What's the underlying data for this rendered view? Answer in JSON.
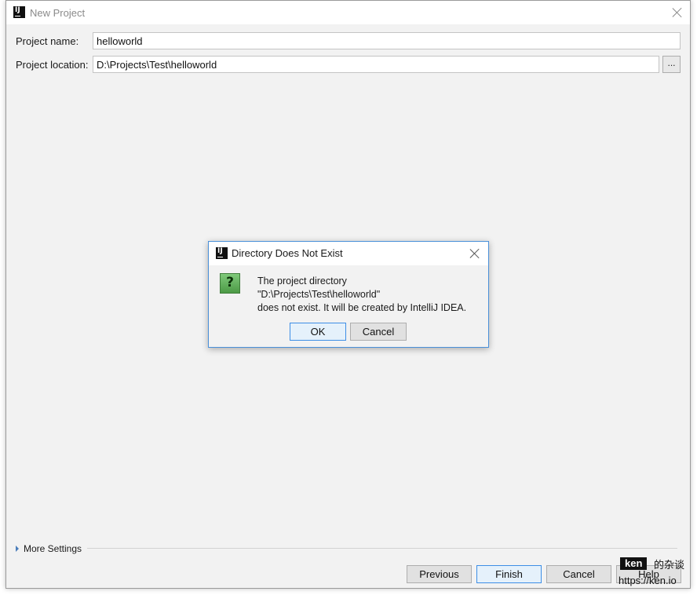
{
  "window": {
    "title": "New Project",
    "logo_text": "IJ"
  },
  "form": {
    "name_label": "Project name:",
    "name_value": "helloworld",
    "location_label": "Project location:",
    "location_value": "D:\\Projects\\Test\\helloworld",
    "browse_label": "..."
  },
  "more_settings": {
    "label": "More Settings"
  },
  "footer": {
    "previous_label": "Previous",
    "finish_label": "Finish",
    "cancel_label": "Cancel",
    "help_label": "Help"
  },
  "dialog": {
    "title": "Directory Does Not Exist",
    "logo_text": "IJ",
    "icon_glyph": "?",
    "message_lines": [
      "The project directory",
      "\"D:\\Projects\\Test\\helloworld\"",
      "does not exist. It will be created by IntelliJ IDEA."
    ],
    "ok_label": "OK",
    "cancel_label": "Cancel"
  },
  "watermark": {
    "badge": "ken",
    "text": "的杂谈",
    "url": "https://ken.io"
  },
  "icons": {
    "app": "intellij-logo-icon",
    "close": "close-icon",
    "question": "question-icon",
    "expand": "triangle-right-icon"
  },
  "colors": {
    "accent": "#3d8ee6",
    "dialog_border": "#4a90d9",
    "question_icon": "#5aaa52"
  }
}
